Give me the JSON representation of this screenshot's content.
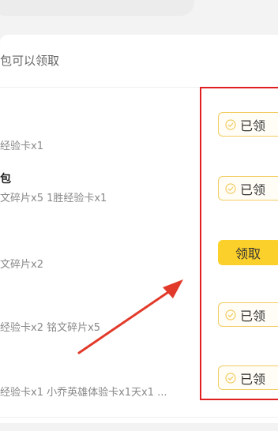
{
  "header": {
    "title": "包可以领取"
  },
  "rewards": [
    {
      "name": "",
      "desc": "经验卡x1",
      "status_label": "已领"
    },
    {
      "name": "包",
      "desc": "文碎片x5 1胜经验卡x1",
      "status_label": "已领"
    },
    {
      "name": "",
      "desc": "文碎片x2",
      "status_label": "领取"
    },
    {
      "name": "",
      "desc": "经验卡x2 铭文碎片x5",
      "status_label": "已领"
    },
    {
      "name": "",
      "desc": "经验卡x1 小乔英雄体验卡x1天x1 ...",
      "status_label": "已领"
    }
  ],
  "colors": {
    "accent_yellow": "#fcd02a",
    "claimed_border": "#f2cc61",
    "annotation_red": "#e02020"
  },
  "icons": {
    "claimed": "check-circle-icon"
  }
}
